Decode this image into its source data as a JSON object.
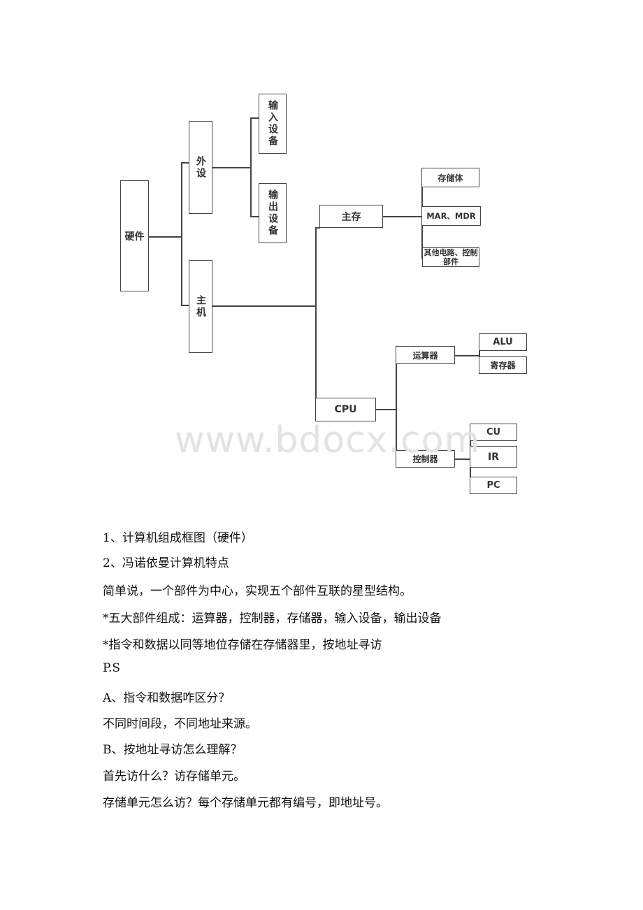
{
  "diagram": {
    "root": "硬件",
    "peripheral": "外设",
    "input_device": "输入设备",
    "output_device": "输出设备",
    "host": "主机",
    "main_memory": "主存",
    "storage_body": "存储体",
    "mar_mdr": "MAR、MDR",
    "other_circuits": "其他电路、控制部件",
    "cpu": "CPU",
    "arithmetic_unit": "运算器",
    "alu": "ALU",
    "register": "寄存器",
    "controller": "控制器",
    "cu": "CU",
    "ir": "IR",
    "pc": "PC"
  },
  "watermark": "www.bdocx.com",
  "lines": [
    "1、计算机组成框图（硬件）",
    "2、冯诺依曼计算机特点",
    "简单说，一个部件为中心，实现五个部件互联的星型结构。",
    "*五大部件组成：运算器，控制器，存储器，输入设备，输出设备",
    "*指令和数据以同等地位存储在存储器里，按地址寻访",
    "P.S",
    "A、指令和数据咋区分？",
    "不同时间段，不同地址来源。",
    "B、按地址寻访怎么理解？",
    "首先访什么？访存储单元。",
    "存储单元怎么访？每个存储单元都有编号，即地址号。"
  ]
}
